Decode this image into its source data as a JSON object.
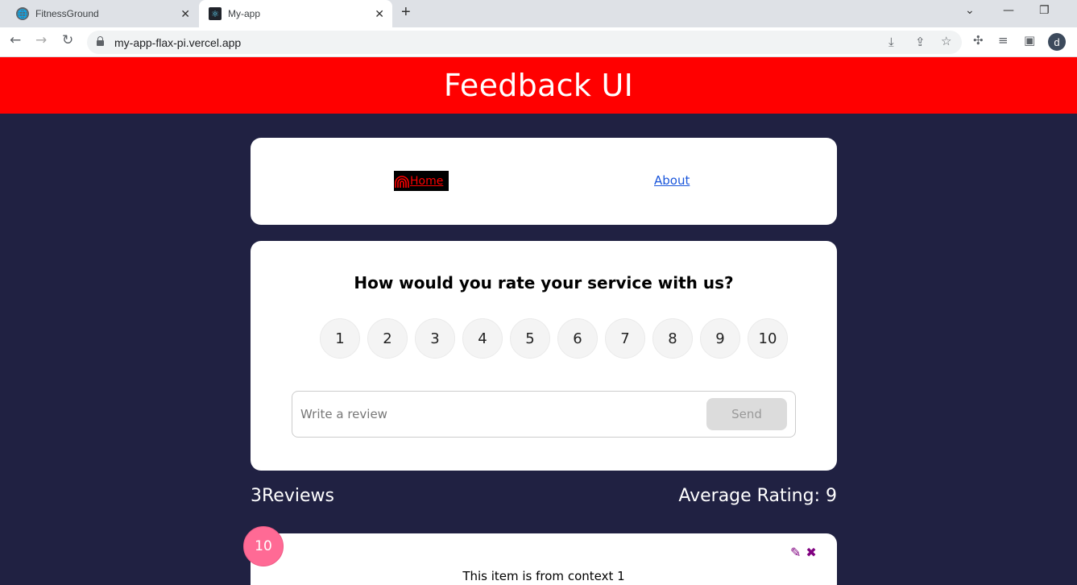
{
  "browser": {
    "tabs": [
      {
        "title": "FitnessGround",
        "favicon": "globe-icon",
        "active": false
      },
      {
        "title": "My-app",
        "favicon": "react-icon",
        "active": true
      }
    ],
    "url": "my-app-flax-pi.vercel.app",
    "profile_initial": "d"
  },
  "header": {
    "title": "Feedback UI"
  },
  "nav": {
    "home_label": "Home",
    "about_label": "About"
  },
  "rating_form": {
    "question": "How would you rate your service with us?",
    "options": [
      "1",
      "2",
      "3",
      "4",
      "5",
      "6",
      "7",
      "8",
      "9",
      "10"
    ],
    "review_placeholder": "Write a review",
    "review_value": "",
    "send_label": "Send"
  },
  "stats": {
    "reviews_count": "3",
    "reviews_label": "Reviews",
    "average_label": "Average Rating: 9"
  },
  "feedback_items": [
    {
      "rating": "10",
      "text": "This item is from context 1"
    }
  ],
  "colors": {
    "header_bg": "#ff0000",
    "page_bg": "#202142",
    "badge_bg": "#ff6a95",
    "action_icons": "#800080",
    "about_link": "#1a56db"
  }
}
